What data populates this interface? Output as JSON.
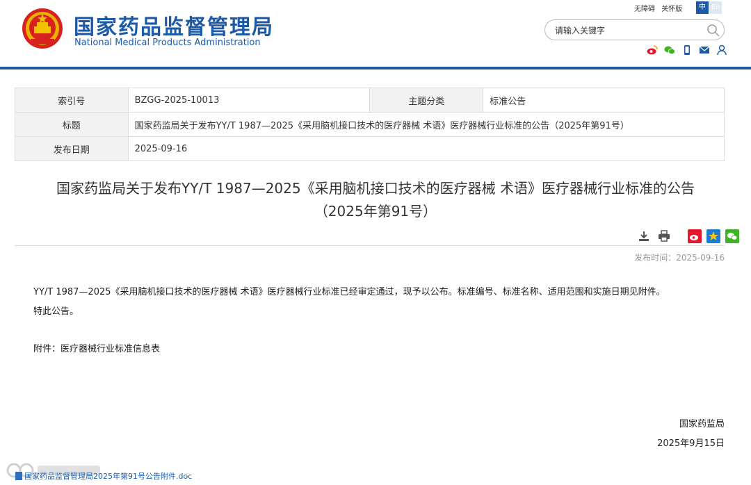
{
  "header": {
    "title_cn": "国家药品监督管理局",
    "title_en": "National Medical Products Administration",
    "links": [
      "无障碍",
      "关怀版"
    ],
    "lang_zh": "中",
    "lang_en": "En",
    "search_placeholder": "请输入关键字",
    "social_icons": [
      "weibo-icon",
      "wechat-icon",
      "mobile-icon",
      "mail-icon",
      "user-icon"
    ],
    "brand_color": "#1c5aa8"
  },
  "info": {
    "index_label": "索引号",
    "index_value": "BZGG-2025-10013",
    "category_label": "主题分类",
    "category_value": "标准公告",
    "title_label": "标题",
    "title_value": "国家药监局关于发布YY/T 1987—2025《采用脑机接口技术的医疗器械 术语》医疗器械行业标准的公告（2025年第91号）",
    "date_label": "发布日期",
    "date_value": "2025-09-16"
  },
  "article": {
    "title_line1": "国家药监局关于发布YY/T 1987—2025《采用脑机接口技术的医疗器械 术语》医疗器械行业标准的公告",
    "title_line2": "（2025年第91号）",
    "tool_icons": [
      "download-icon",
      "print-icon",
      "weibo-share-icon",
      "favorite-icon",
      "wechat-share-icon"
    ],
    "pub_time": "发布时间：2025-09-16",
    "paragraph1": "YY/T 1987—2025《采用脑机接口技术的医疗器械 术语》医疗器械行业标准已经审定通过，现予以公布。标准编号、标准名称、适用范围和实施日期见附件。",
    "paragraph2": "特此公告。",
    "attachment_note": "附件：医疗器械行业标准信息表",
    "signature_org": "国家药监局",
    "signature_date": "2025年9月15日",
    "attachment_link": "国家药品监督管理局2025年第91号公告附件.doc"
  }
}
